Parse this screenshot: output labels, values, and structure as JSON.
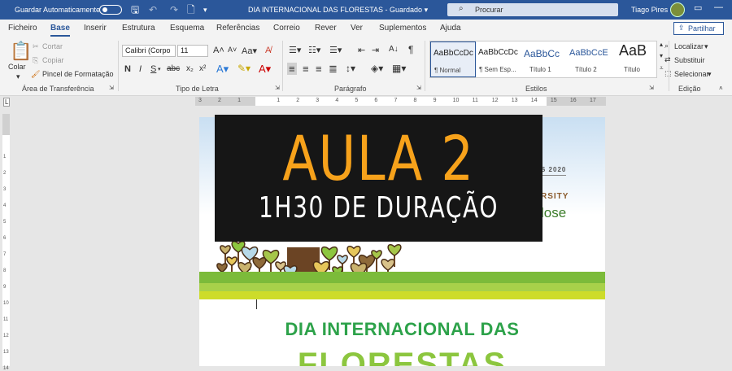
{
  "titlebar": {
    "autosave_label": "Guardar Automaticamente",
    "doc_title": "DIA INTERNACIONAL DAS FLORESTAS  -  Guardado  ▾",
    "search_placeholder": "Procurar",
    "user_name": "Tiago Pires",
    "minimize_glyph": "—",
    "restore_glyph": "❐"
  },
  "tabs": [
    "Ficheiro",
    "Base",
    "Inserir",
    "Estrutura",
    "Esquema",
    "Referências",
    "Correio",
    "Rever",
    "Ver",
    "Suplementos",
    "Ajuda"
  ],
  "active_tab": "Base",
  "share_label": "Partilhar",
  "clipboard": {
    "paste": "Colar",
    "cut": "Cortar",
    "copy": "Copiar",
    "format_painter": "Pincel de Formatação",
    "group": "Área de Transferência"
  },
  "font": {
    "name": "Calibri (Corpo",
    "size": "11",
    "group": "Tipo de Letra"
  },
  "paragraph": {
    "group": "Parágrafo"
  },
  "styles": {
    "items": [
      {
        "preview": "AaBbCcDc",
        "name": "¶ Normal"
      },
      {
        "preview": "AaBbCcDc",
        "name": "¶ Sem Esp..."
      },
      {
        "preview": "AaBbCc",
        "name": "Título 1"
      },
      {
        "preview": "AaBbCcE",
        "name": "Título 2"
      },
      {
        "preview": "AaB",
        "name": "Título"
      }
    ],
    "group": "Estilos"
  },
  "editing": {
    "find": "Localizar",
    "replace": "Substituir",
    "select": "Selecionar",
    "group": "Edição"
  },
  "ruler": {
    "marks": [
      "3",
      "2",
      "1",
      "1",
      "2",
      "3",
      "4",
      "5",
      "6",
      "7",
      "8",
      "9",
      "10",
      "11",
      "12",
      "13",
      "14",
      "15",
      "16",
      "17"
    ]
  },
  "document": {
    "ghost_year": "S 2020",
    "ghost_sub": "RSITY",
    "ghost_word": "lose",
    "heading1": "DIA INTERNACIONAL DAS",
    "heading2": "FLORESTAS"
  },
  "overlay": {
    "title": "AULA 2",
    "subtitle": "1H30 DE DURAÇÃO"
  },
  "colors": {
    "word_blue": "#2b579a",
    "overlay_bg": "#161616",
    "overlay_title": "#f7a21b",
    "heading_green": "#2da24a",
    "heading_light_green": "#8cc63f"
  }
}
